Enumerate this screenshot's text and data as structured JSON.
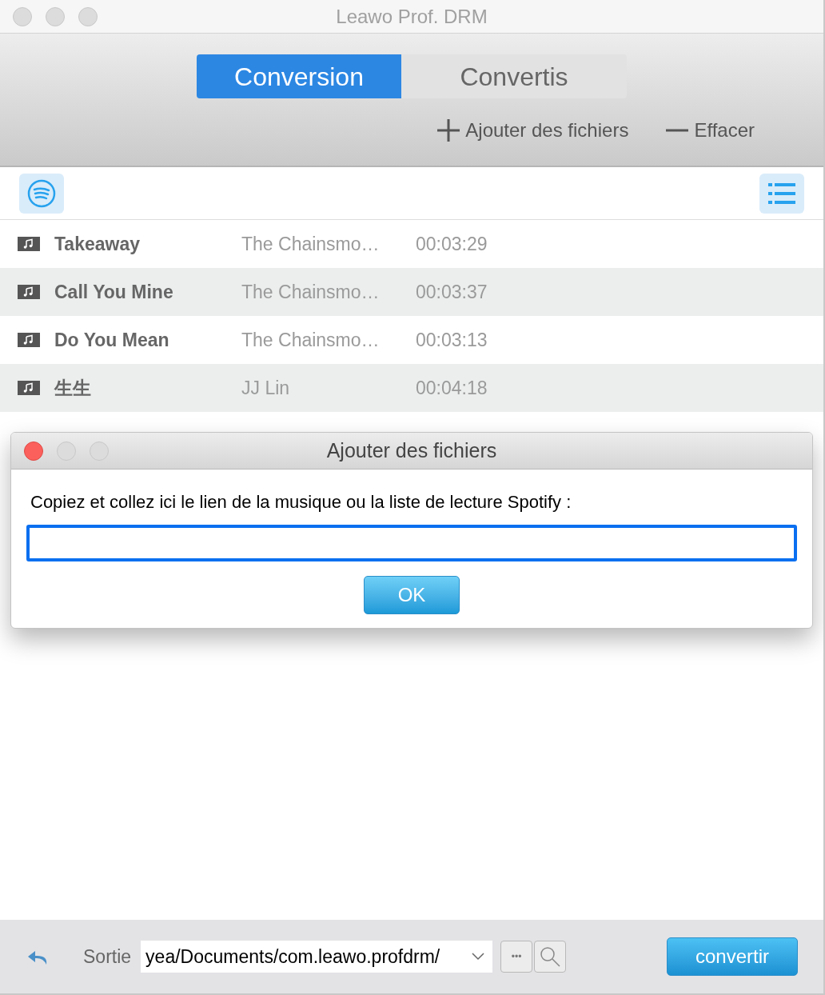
{
  "window": {
    "title": "Leawo Prof. DRM"
  },
  "tabs": [
    {
      "label": "Conversion",
      "selected": true
    },
    {
      "label": "Convertis",
      "selected": false
    }
  ],
  "actions": [
    {
      "kind": "add",
      "label": "Ajouter des fichiers"
    },
    {
      "kind": "remove",
      "label": "Effacer"
    }
  ],
  "tracks": [
    {
      "title": "Takeaway",
      "artist": "The Chainsmo…",
      "duration": "00:03:29"
    },
    {
      "title": "Call You Mine",
      "artist": "The Chainsmo…",
      "duration": "00:03:37"
    },
    {
      "title": "Do You Mean",
      "artist": "The Chainsmo…",
      "duration": "00:03:13"
    },
    {
      "title": "生生",
      "artist": "JJ Lin",
      "duration": "00:04:18"
    }
  ],
  "dialog": {
    "title": "Ajouter des fichiers",
    "prompt": "Copiez et collez ici le lien de la musique ou la liste de lecture Spotify :",
    "button": "OK"
  },
  "bottom_bar": {
    "output_label": "Sortie",
    "output_path": "yea/Documents/com.leawo.profdrm/",
    "browse_button": "•••",
    "convert_button": "convertir"
  }
}
